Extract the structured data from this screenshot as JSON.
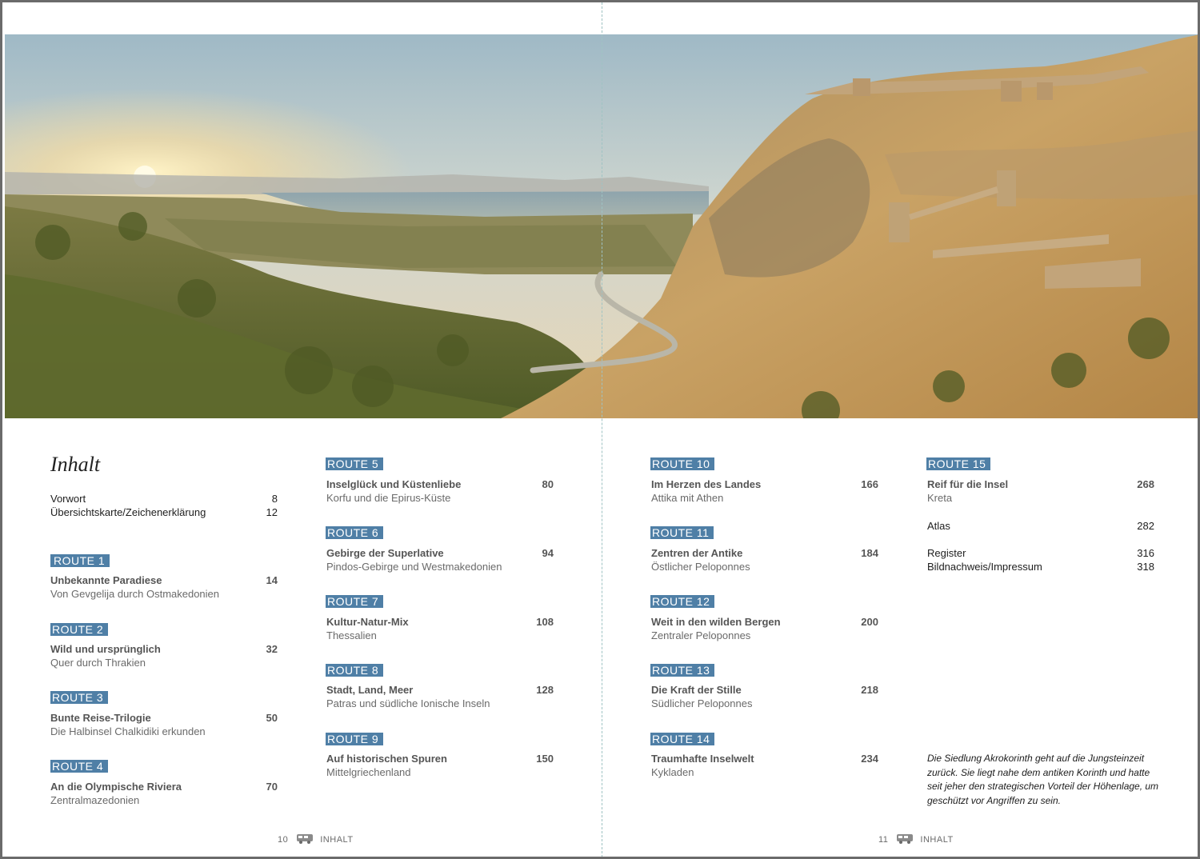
{
  "left_page": {
    "title": "Inhalt",
    "front_matter": [
      {
        "label": "Vorwort",
        "page": "8"
      },
      {
        "label": "Übersichtskarte/Zeichenerklärung",
        "page": "12"
      }
    ],
    "col1_routes": [
      {
        "badge": "ROUTE 1",
        "title": "Unbekannte Paradiese",
        "page": "14",
        "subtitle": "Von Gevgelija durch Ostmakedonien"
      },
      {
        "badge": "ROUTE 2",
        "title": "Wild und ursprünglich",
        "page": "32",
        "subtitle": "Quer durch Thrakien"
      },
      {
        "badge": "ROUTE 3",
        "title": "Bunte Reise-Trilogie",
        "page": "50",
        "subtitle": "Die Halbinsel Chalkidiki erkunden"
      },
      {
        "badge": "ROUTE 4",
        "title": "An die Olympische Riviera",
        "page": "70",
        "subtitle": "Zentralmazedonien"
      }
    ],
    "col2_routes": [
      {
        "badge": "ROUTE 5",
        "title": "Inselglück und Küstenliebe",
        "page": "80",
        "subtitle": "Korfu und die Epirus-Küste"
      },
      {
        "badge": "ROUTE 6",
        "title": "Gebirge der Superlative",
        "page": "94",
        "subtitle": "Pindos-Gebirge und Westmakedonien"
      },
      {
        "badge": "ROUTE 7",
        "title": "Kultur-Natur-Mix",
        "page": "108",
        "subtitle": "Thessalien"
      },
      {
        "badge": "ROUTE 8",
        "title": "Stadt, Land, Meer",
        "page": "128",
        "subtitle": "Patras und südliche Ionische Inseln"
      },
      {
        "badge": "ROUTE 9",
        "title": "Auf historischen Spuren",
        "page": "150",
        "subtitle": "Mittelgriechenland"
      }
    ],
    "footer": {
      "page_number": "10",
      "label": "INHALT",
      "icon": "camper-van-icon"
    }
  },
  "right_page": {
    "col3_routes": [
      {
        "badge": "ROUTE 10",
        "title": "Im Herzen des Landes",
        "page": "166",
        "subtitle": "Attika mit Athen"
      },
      {
        "badge": "ROUTE 11",
        "title": "Zentren der Antike",
        "page": "184",
        "subtitle": "Östlicher Peloponnes"
      },
      {
        "badge": "ROUTE 12",
        "title": "Weit in den wilden Bergen",
        "page": "200",
        "subtitle": "Zentraler Peloponnes"
      },
      {
        "badge": "ROUTE 13",
        "title": "Die Kraft der Stille",
        "page": "218",
        "subtitle": "Südlicher Peloponnes"
      },
      {
        "badge": "ROUTE 14",
        "title": "Traumhafte Inselwelt",
        "page": "234",
        "subtitle": "Kykladen"
      }
    ],
    "route15": {
      "badge": "ROUTE 15",
      "title": "Reif für die Insel",
      "page": "268",
      "subtitle": "Kreta"
    },
    "back_matter": [
      {
        "label": "Atlas",
        "page": "282"
      },
      {
        "label": "Register",
        "page": "316"
      },
      {
        "label": "Bildnachweis/Impressum",
        "page": "318"
      }
    ],
    "caption": "Die Siedlung Akrokorinth geht auf die Jungsteinzeit zurück. Sie liegt nahe dem antiken Korinth und hatte seit jeher den strategischen Vorteil der Höhenlage, um geschützt vor Angriffen zu sein.",
    "footer": {
      "page_number": "11",
      "label": "INHALT",
      "icon": "camper-van-icon"
    }
  },
  "colors": {
    "route_badge": "#4f7fa6",
    "border": "#6b6b6b"
  }
}
